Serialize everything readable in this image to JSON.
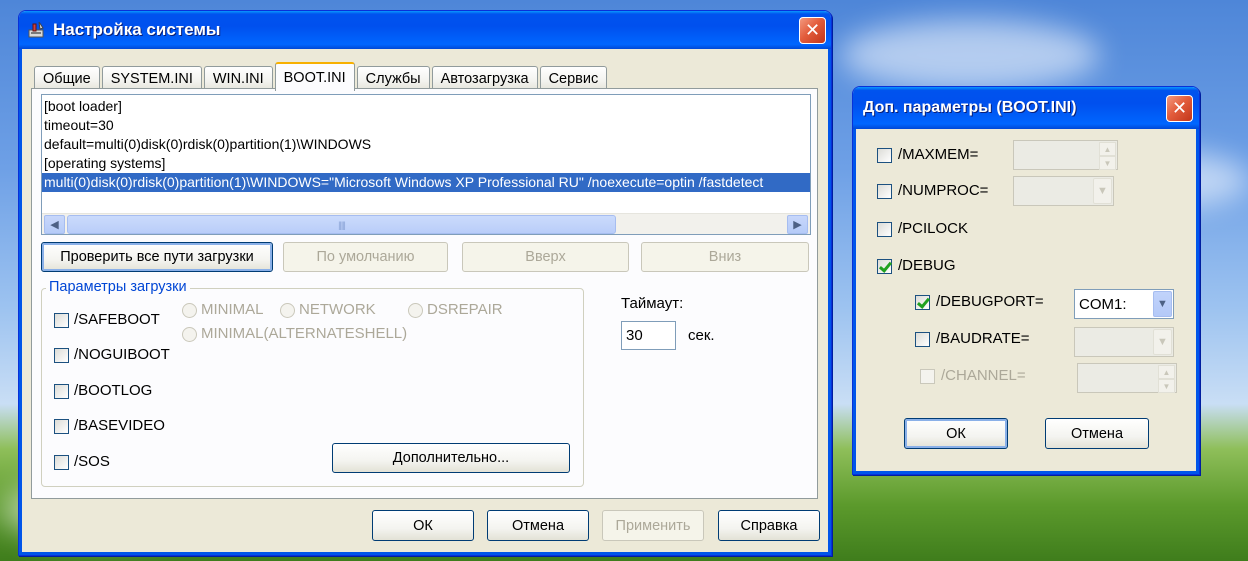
{
  "main_window": {
    "title": "Настройка системы",
    "tabs": [
      "Общие",
      "SYSTEM.INI",
      "WIN.INI",
      "BOOT.INI",
      "Службы",
      "Автозагрузка",
      "Сервис"
    ],
    "active_tab": "BOOT.INI",
    "boot_lines": [
      "[boot loader]",
      "timeout=30",
      "default=multi(0)disk(0)rdisk(0)partition(1)\\WINDOWS",
      "[operating systems]",
      "multi(0)disk(0)rdisk(0)partition(1)\\WINDOWS=\"Microsoft Windows XP Professional RU\" /noexecute=optin /fastdetect"
    ],
    "selected_line_index": 4,
    "buttons_row": {
      "check_all": "Проверить все пути загрузки",
      "default": "По умолчанию",
      "up": "Вверх",
      "down": "Вниз"
    },
    "boot_params": {
      "group_title": "Параметры загрузки",
      "safeboot": "/SAFEBOOT",
      "noguiboot": "/NOGUIBOOT",
      "bootlog": "/BOOTLOG",
      "basevideo": "/BASEVIDEO",
      "sos": "/SOS",
      "radio_minimal": "MINIMAL",
      "radio_network": "NETWORK",
      "radio_dsrepair": "DSREPAIR",
      "radio_altshell": "MINIMAL(ALTERNATESHELL)",
      "advanced_button": "Дополнительно..."
    },
    "timeout": {
      "label": "Таймаут:",
      "value": "30",
      "unit": "сек."
    },
    "footer": {
      "ok": "ОК",
      "cancel": "Отмена",
      "apply": "Применить",
      "help": "Справка"
    }
  },
  "dialog": {
    "title": "Доп. параметры (BOOT.INI)",
    "maxmem": "/MAXMEM=",
    "numproc": "/NUMPROC=",
    "pcilock": "/PCILOCK",
    "debug": "/DEBUG",
    "debug_checked": true,
    "debugport": "/DEBUGPORT=",
    "debugport_checked": true,
    "debugport_value": "COM1:",
    "baudrate": "/BAUDRATE=",
    "channel": "/CHANNEL=",
    "ok": "ОК",
    "cancel": "Отмена"
  },
  "colors": {
    "titlebar": "#0055ea",
    "window_bg": "#ece9d8",
    "selection": "#316ac5",
    "group_title": "#0046d5",
    "check_mark": "#21a121"
  }
}
